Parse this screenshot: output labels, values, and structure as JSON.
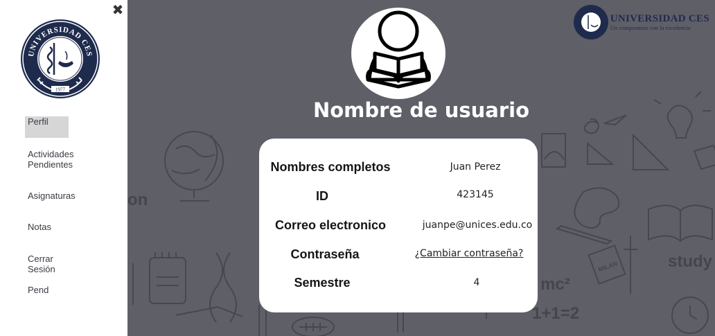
{
  "sidebar": {
    "close_label": "✖",
    "logo_text": "UNIVERSIDAD CES",
    "logo_year": "1977",
    "items": [
      {
        "label": "Perfil",
        "active": true
      },
      {
        "label": "Actividades Pendientes"
      },
      {
        "label": "Asignaturas"
      },
      {
        "label": "Notas"
      },
      {
        "label": "Cerrar Sesión"
      },
      {
        "label": "Pend"
      }
    ]
  },
  "header": {
    "brand_name": "UNIVERSIDAD CES",
    "brand_tagline": "Un compromiso con la excelencia"
  },
  "profile": {
    "title": "Nombre de usuario",
    "fields": [
      {
        "label": "Nombres completos",
        "value": "Juan Perez"
      },
      {
        "label": "ID",
        "value": "423145"
      },
      {
        "label": "Correo electronico",
        "value": "juanpe@unices.edu.co"
      },
      {
        "label": "Contraseña",
        "value": "¿Cambiar contraseña?"
      },
      {
        "label": "Semestre",
        "value": "4"
      }
    ]
  },
  "background": {
    "words": [
      "on",
      "study",
      "mc²",
      "1+1=2",
      "MILAN"
    ]
  },
  "colors": {
    "sidebar_bg": "#ffffff",
    "main_bg": "#5f5f68",
    "card_bg": "#ffffff",
    "brand_navy": "#1f2b4d",
    "active_item_bg": "#d6d6d6"
  },
  "icons": {
    "close": "close-icon",
    "avatar": "user-reading-icon",
    "seal": "university-seal-icon"
  }
}
